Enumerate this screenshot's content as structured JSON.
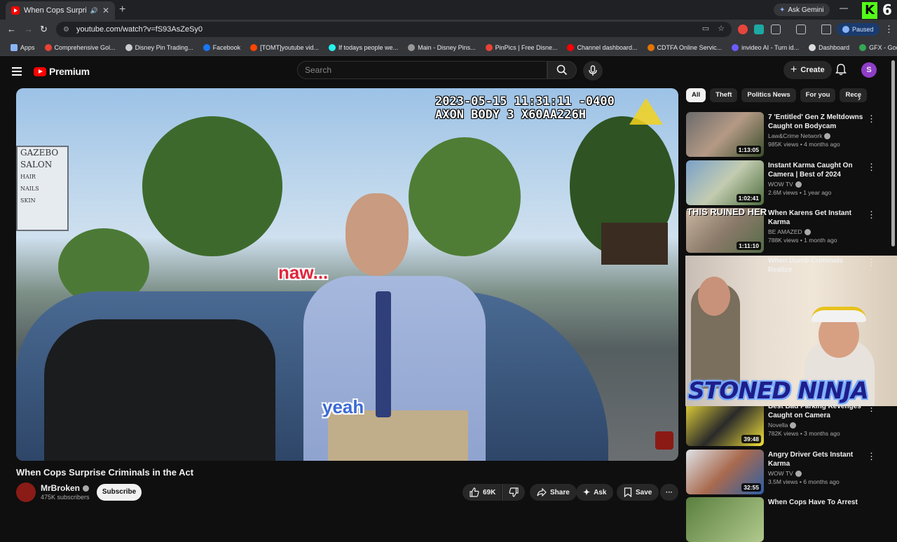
{
  "browser": {
    "tab_title": "When Cops Surprise Criminals in the Act",
    "url": "youtube.com/watch?v=fS93AsZeSy0",
    "ask_gemini": "Ask Gemini",
    "profile_status": "Paused",
    "kick_badge": "K",
    "kick_count": "6",
    "bookmarks": [
      {
        "label": "Apps",
        "color": "#8ab4f8"
      },
      {
        "label": "Comprehensive Gol...",
        "color": "#e94235"
      },
      {
        "label": "Disney Pin Trading...",
        "color": "#cccccc"
      },
      {
        "label": "Facebook",
        "color": "#1877f2"
      },
      {
        "label": "[TOMT]youtube vid...",
        "color": "#ff4500"
      },
      {
        "label": "If todays people we...",
        "color": "#25f4ee"
      },
      {
        "label": "Main - Disney Pins...",
        "color": "#999999"
      },
      {
        "label": "PinPics | Free Disne...",
        "color": "#e94235"
      },
      {
        "label": "Channel dashboard...",
        "color": "#ff0000"
      },
      {
        "label": "CDTFA Online Servic...",
        "color": "#e37400"
      },
      {
        "label": "invideo AI - Turn id...",
        "color": "#6a5cff"
      },
      {
        "label": "Dashboard",
        "color": "#dddddd"
      },
      {
        "label": "GFX - Google Drive",
        "color": "#34a853"
      }
    ]
  },
  "youtube": {
    "logo_text": "Premium",
    "search_placeholder": "Search",
    "create_label": "Create",
    "avatar_letter": "S",
    "video": {
      "timestamp_line1": "2023-05-15 11:31:11 -0400",
      "timestamp_line2": "AXON BODY 3 X60AA226H",
      "caption_1": "naw...",
      "caption_2": "yeah",
      "sign_lines": [
        "GAZEBO",
        "SALON",
        "HAIR",
        "NAILS",
        "SKIN"
      ]
    },
    "title": "When Cops Surprise Criminals in the Act",
    "channel": {
      "name": "MrBroken",
      "subscribers": "475K subscribers"
    },
    "subscribe_label": "Subscribe",
    "actions": {
      "likes": "69K",
      "share": "Share",
      "ask": "Ask",
      "save": "Save"
    },
    "chips": [
      "All",
      "Theft",
      "Politics News",
      "For you",
      "Rece"
    ],
    "overlay_text": "THIS RUINED HER",
    "streamer_overlay": "STONED NINJA",
    "recommendations": [
      {
        "title": "7 'Entitled' Gen Z Meltdowns Caught on Bodycam",
        "channel": "Law&Crime Network",
        "meta": "985K views • 4 months ago",
        "duration": "1:13:05"
      },
      {
        "title": "Instant Karma Caught On Camera | Best of 2024",
        "channel": "WOW TV",
        "meta": "2.6M views • 1 year ago",
        "duration": "1:02:41"
      },
      {
        "title": "When Karens Get Instant Karma",
        "channel": "BE AMAZED",
        "meta": "788K views • 1 month ago",
        "duration": "1:11:10"
      },
      {
        "title": "When Dumb Criminals Realize",
        "channel": "",
        "meta": "",
        "duration": ""
      },
      {
        "title": "Best Bad Parking Revenges Caught on Camera",
        "channel": "Novella",
        "meta": "782K views • 3 months ago",
        "duration": "39:48"
      },
      {
        "title": "Angry Driver Gets Instant Karma",
        "channel": "WOW TV",
        "meta": "3.5M views • 6 months ago",
        "duration": "32:55"
      },
      {
        "title": "When Cops Have To Arrest",
        "channel": "",
        "meta": "",
        "duration": ""
      }
    ]
  }
}
